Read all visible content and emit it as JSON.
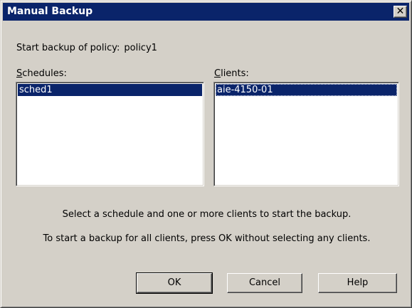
{
  "window": {
    "title": "Manual Backup",
    "close_glyph": "✕"
  },
  "policy": {
    "label": "Start backup of policy:",
    "name": "policy1"
  },
  "schedules": {
    "label_mnemonic": "S",
    "label_rest": "chedules:",
    "items": [
      {
        "label": "sched1",
        "selected": true
      }
    ]
  },
  "clients": {
    "label_mnemonic": "C",
    "label_rest": "lients:",
    "items": [
      {
        "label": "aie-4150-01",
        "selected": true
      }
    ]
  },
  "info": {
    "line1": "Select a schedule and one or more clients to start the backup.",
    "line2": "To start a backup for all clients, press OK without selecting any clients."
  },
  "buttons": {
    "ok": "OK",
    "cancel": "Cancel",
    "help": "Help"
  },
  "colors": {
    "selection": "#0a246a",
    "titlebar": "#0a246a",
    "face": "#d4d0c8"
  }
}
